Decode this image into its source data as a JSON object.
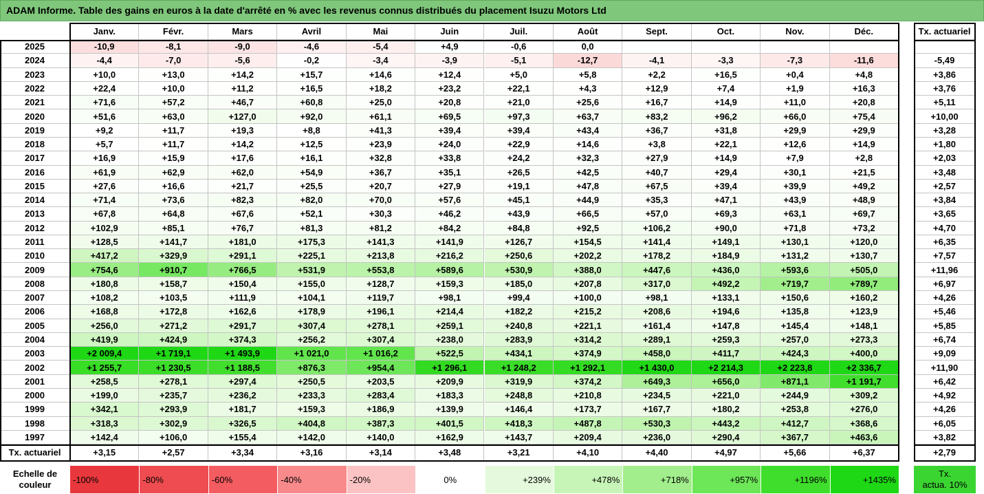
{
  "colors": {
    "title_bar": "#7fc77b"
  },
  "chart_data": {
    "type": "heatmap",
    "title": "ADAM Informe. Table des gains en euros à la date d'arrêté en % avec les revenus connus distribués du placement Isuzu Motors Ltd",
    "columns": [
      "Janv.",
      "Févr.",
      "Mars",
      "Avril",
      "Mai",
      "Juin",
      "Juil.",
      "Août",
      "Sept.",
      "Oct.",
      "Nov.",
      "Déc."
    ],
    "total_column": "Tx. actuariel",
    "rows": [
      {
        "year": "2025",
        "values": [
          "-10,9",
          "-8,1",
          "-9,0",
          "-4,6",
          "-5,4",
          "+4,9",
          "-0,6",
          "0,0",
          "",
          "",
          "",
          ""
        ],
        "total": ""
      },
      {
        "year": "2024",
        "values": [
          "-4,4",
          "-7,0",
          "-5,6",
          "-0,2",
          "-3,4",
          "-3,9",
          "-5,1",
          "-12,7",
          "-4,1",
          "-3,3",
          "-7,3",
          "-11,6"
        ],
        "total": "-5,49"
      },
      {
        "year": "2023",
        "values": [
          "+10,0",
          "+13,0",
          "+14,2",
          "+15,7",
          "+14,6",
          "+12,4",
          "+5,0",
          "+5,8",
          "+2,2",
          "+16,5",
          "+0,4",
          "+4,8"
        ],
        "total": "+3,86"
      },
      {
        "year": "2022",
        "values": [
          "+22,4",
          "+10,0",
          "+11,2",
          "+16,5",
          "+18,2",
          "+23,2",
          "+22,1",
          "+4,3",
          "+12,9",
          "+7,4",
          "+1,9",
          "+16,3"
        ],
        "total": "+3,76"
      },
      {
        "year": "2021",
        "values": [
          "+71,6",
          "+57,2",
          "+46,7",
          "+60,8",
          "+25,0",
          "+20,8",
          "+21,0",
          "+25,6",
          "+16,7",
          "+14,9",
          "+11,0",
          "+20,8"
        ],
        "total": "+5,11"
      },
      {
        "year": "2020",
        "values": [
          "+51,6",
          "+63,0",
          "+127,0",
          "+92,0",
          "+61,1",
          "+69,5",
          "+97,3",
          "+63,7",
          "+83,2",
          "+96,2",
          "+66,0",
          "+75,4"
        ],
        "total": "+10,00"
      },
      {
        "year": "2019",
        "values": [
          "+9,2",
          "+11,7",
          "+19,3",
          "+8,8",
          "+41,3",
          "+39,4",
          "+39,4",
          "+43,4",
          "+36,7",
          "+31,8",
          "+29,9",
          "+29,9"
        ],
        "total": "+3,28"
      },
      {
        "year": "2018",
        "values": [
          "+5,7",
          "+11,7",
          "+14,2",
          "+12,5",
          "+23,9",
          "+24,0",
          "+22,9",
          "+14,6",
          "+3,8",
          "+22,1",
          "+12,6",
          "+14,9"
        ],
        "total": "+1,80"
      },
      {
        "year": "2017",
        "values": [
          "+16,9",
          "+15,9",
          "+17,6",
          "+16,1",
          "+32,8",
          "+33,8",
          "+24,2",
          "+32,3",
          "+27,9",
          "+14,9",
          "+7,9",
          "+2,8"
        ],
        "total": "+2,03"
      },
      {
        "year": "2016",
        "values": [
          "+61,9",
          "+62,9",
          "+62,0",
          "+54,9",
          "+36,7",
          "+35,1",
          "+26,5",
          "+42,5",
          "+40,7",
          "+29,4",
          "+30,1",
          "+21,5"
        ],
        "total": "+3,48"
      },
      {
        "year": "2015",
        "values": [
          "+27,6",
          "+16,6",
          "+21,7",
          "+25,5",
          "+20,7",
          "+27,9",
          "+19,1",
          "+47,8",
          "+67,5",
          "+39,4",
          "+39,9",
          "+49,2"
        ],
        "total": "+2,57"
      },
      {
        "year": "2014",
        "values": [
          "+71,4",
          "+73,6",
          "+82,3",
          "+82,0",
          "+70,0",
          "+57,6",
          "+45,1",
          "+44,9",
          "+35,3",
          "+47,1",
          "+43,9",
          "+48,9"
        ],
        "total": "+3,84"
      },
      {
        "year": "2013",
        "values": [
          "+67,8",
          "+64,8",
          "+67,6",
          "+52,1",
          "+30,3",
          "+46,2",
          "+43,9",
          "+66,5",
          "+57,0",
          "+69,3",
          "+63,1",
          "+69,7"
        ],
        "total": "+3,65"
      },
      {
        "year": "2012",
        "values": [
          "+102,9",
          "+85,1",
          "+76,7",
          "+81,3",
          "+81,2",
          "+84,2",
          "+84,8",
          "+92,5",
          "+106,2",
          "+90,0",
          "+71,8",
          "+73,2"
        ],
        "total": "+4,70"
      },
      {
        "year": "2011",
        "values": [
          "+128,5",
          "+141,7",
          "+181,0",
          "+175,3",
          "+141,3",
          "+141,9",
          "+126,7",
          "+154,5",
          "+141,4",
          "+149,1",
          "+130,1",
          "+120,0"
        ],
        "total": "+6,35"
      },
      {
        "year": "2010",
        "values": [
          "+417,2",
          "+329,9",
          "+291,1",
          "+225,1",
          "+213,8",
          "+216,2",
          "+250,6",
          "+202,2",
          "+178,2",
          "+184,9",
          "+131,2",
          "+130,7"
        ],
        "total": "+7,57"
      },
      {
        "year": "2009",
        "values": [
          "+754,6",
          "+910,7",
          "+766,5",
          "+531,9",
          "+553,8",
          "+589,6",
          "+530,9",
          "+388,0",
          "+447,6",
          "+436,0",
          "+593,6",
          "+505,0"
        ],
        "total": "+11,96"
      },
      {
        "year": "2008",
        "values": [
          "+180,8",
          "+158,7",
          "+150,4",
          "+155,0",
          "+128,7",
          "+159,3",
          "+185,0",
          "+207,8",
          "+317,0",
          "+492,2",
          "+719,7",
          "+789,7"
        ],
        "total": "+6,97"
      },
      {
        "year": "2007",
        "values": [
          "+108,2",
          "+103,5",
          "+111,9",
          "+104,1",
          "+119,7",
          "+98,1",
          "+99,4",
          "+100,0",
          "+98,1",
          "+133,1",
          "+150,6",
          "+160,2"
        ],
        "total": "+4,26"
      },
      {
        "year": "2006",
        "values": [
          "+168,8",
          "+172,8",
          "+162,6",
          "+178,9",
          "+196,1",
          "+214,4",
          "+182,2",
          "+215,2",
          "+208,6",
          "+194,6",
          "+135,8",
          "+123,9"
        ],
        "total": "+5,46"
      },
      {
        "year": "2005",
        "values": [
          "+256,0",
          "+271,2",
          "+291,7",
          "+307,4",
          "+278,1",
          "+259,1",
          "+240,8",
          "+221,1",
          "+161,4",
          "+147,8",
          "+145,4",
          "+148,1"
        ],
        "total": "+5,85"
      },
      {
        "year": "2004",
        "values": [
          "+419,9",
          "+424,9",
          "+374,3",
          "+256,2",
          "+307,4",
          "+238,0",
          "+283,9",
          "+314,2",
          "+289,1",
          "+259,3",
          "+257,0",
          "+273,3"
        ],
        "total": "+6,74"
      },
      {
        "year": "2003",
        "values": [
          "+2 009,4",
          "+1 719,1",
          "+1 493,9",
          "+1 021,0",
          "+1 016,2",
          "+522,5",
          "+434,1",
          "+374,9",
          "+458,0",
          "+411,7",
          "+424,3",
          "+400,0"
        ],
        "total": "+9,09"
      },
      {
        "year": "2002",
        "values": [
          "+1 255,7",
          "+1 230,5",
          "+1 188,5",
          "+876,3",
          "+954,4",
          "+1 296,1",
          "+1 248,2",
          "+1 292,1",
          "+1 430,0",
          "+2 214,3",
          "+2 223,8",
          "+2 336,7"
        ],
        "total": "+11,90"
      },
      {
        "year": "2001",
        "values": [
          "+258,5",
          "+278,1",
          "+297,4",
          "+250,5",
          "+203,5",
          "+209,9",
          "+319,9",
          "+374,2",
          "+649,3",
          "+656,0",
          "+871,1",
          "+1 191,7"
        ],
        "total": "+6,42"
      },
      {
        "year": "2000",
        "values": [
          "+199,0",
          "+235,7",
          "+236,2",
          "+233,3",
          "+283,4",
          "+183,3",
          "+248,8",
          "+210,8",
          "+234,5",
          "+221,0",
          "+244,9",
          "+309,2"
        ],
        "total": "+4,92"
      },
      {
        "year": "1999",
        "values": [
          "+342,1",
          "+293,9",
          "+181,7",
          "+159,3",
          "+186,9",
          "+139,9",
          "+146,4",
          "+173,7",
          "+167,7",
          "+180,2",
          "+253,8",
          "+276,0"
        ],
        "total": "+4,26"
      },
      {
        "year": "1998",
        "values": [
          "+318,3",
          "+302,9",
          "+326,5",
          "+404,8",
          "+387,3",
          "+401,5",
          "+418,3",
          "+487,8",
          "+530,3",
          "+443,2",
          "+412,7",
          "+368,6"
        ],
        "total": "+6,05"
      },
      {
        "year": "1997",
        "values": [
          "+142,4",
          "+106,0",
          "+155,4",
          "+142,0",
          "+140,0",
          "+162,9",
          "+143,7",
          "+209,4",
          "+236,0",
          "+290,4",
          "+367,7",
          "+463,6"
        ],
        "total": "+3,82"
      }
    ],
    "total_row": {
      "label": "Tx. actuariel",
      "values": [
        "+3,15",
        "+2,57",
        "+3,34",
        "+3,16",
        "+3,14",
        "+3,48",
        "+3,21",
        "+4,10",
        "+4,40",
        "+4,97",
        "+5,66",
        "+6,37"
      ],
      "total": "+2,79"
    },
    "color_scale": {
      "label": "Echelle de couleur",
      "stops": [
        {
          "label": "-100%",
          "color": "#e8383d"
        },
        {
          "label": "-80%",
          "color": "#ee4c50"
        },
        {
          "label": "-60%",
          "color": "#f35c60"
        },
        {
          "label": "-40%",
          "color": "#f88a8c"
        },
        {
          "label": "-20%",
          "color": "#fbc3c3"
        },
        {
          "label": "0%",
          "color": "#ffffff"
        },
        {
          "label": "+239%",
          "color": "#e5fadd"
        },
        {
          "label": "+478%",
          "color": "#c7f5b8"
        },
        {
          "label": "+718%",
          "color": "#a2ee8c"
        },
        {
          "label": "+957%",
          "color": "#6de658"
        },
        {
          "label": "+1196%",
          "color": "#40de2c"
        },
        {
          "label": "+1435%",
          "color": "#1fd815"
        }
      ],
      "extra": {
        "label": "Tx. actua. 10%",
        "color": "#3bd532"
      }
    }
  }
}
